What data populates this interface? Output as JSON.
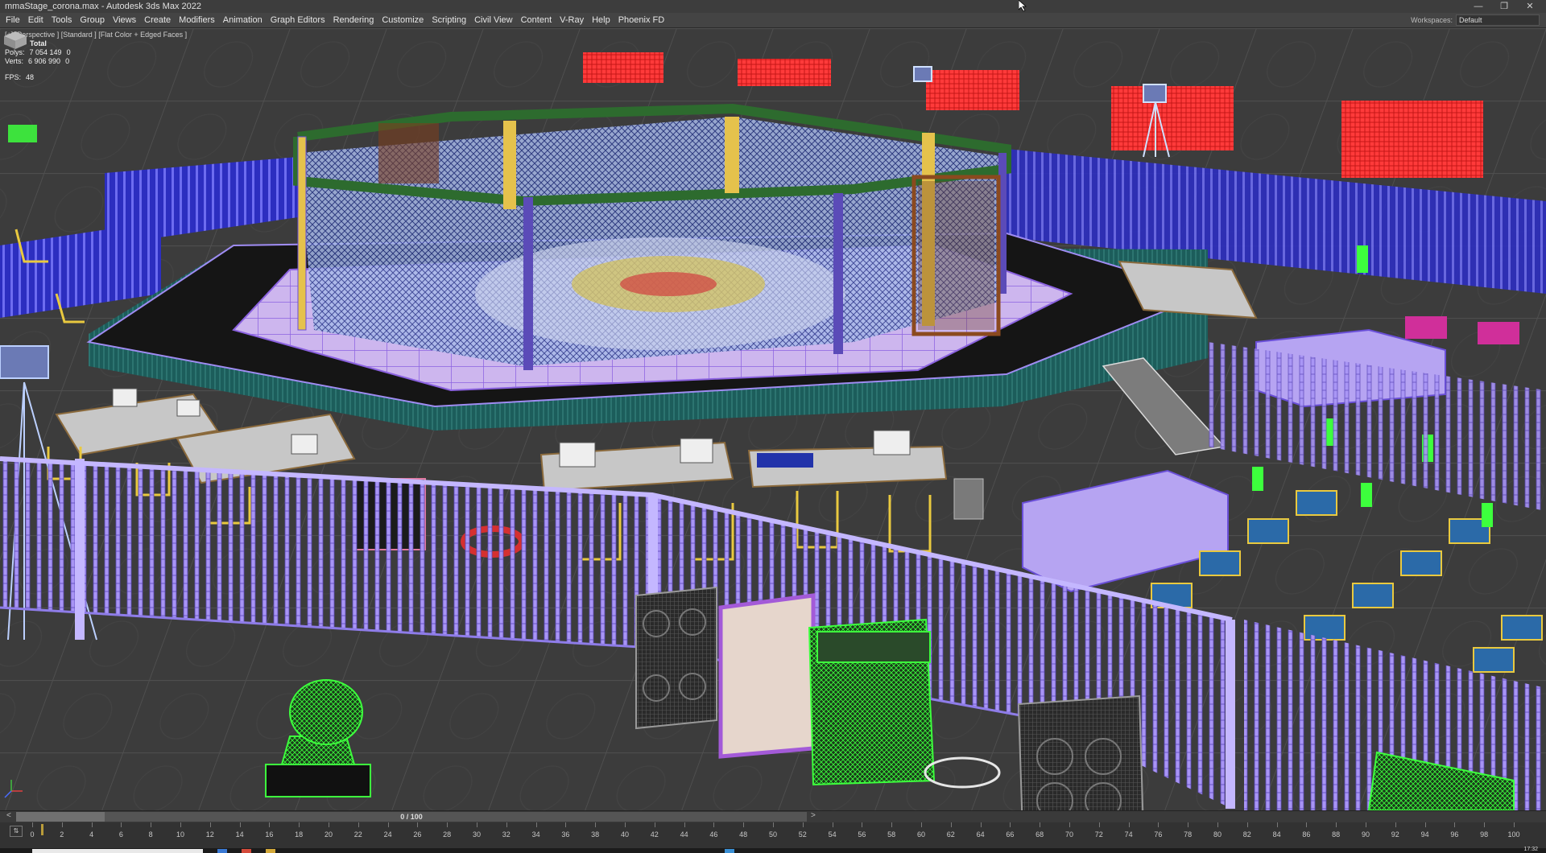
{
  "window": {
    "title": "mmaStage_corona.max - Autodesk 3ds Max 2022",
    "buttons": [
      "minimize",
      "restore",
      "close"
    ]
  },
  "menubar": {
    "items": [
      "File",
      "Edit",
      "Tools",
      "Group",
      "Views",
      "Create",
      "Modifiers",
      "Animation",
      "Graph Editors",
      "Rendering",
      "Customize",
      "Scripting",
      "Civil View",
      "Content",
      "V-Ray",
      "Help",
      "Phoenix FD"
    ],
    "workspace_label": "Workspaces:",
    "workspace_value": "Default"
  },
  "viewport": {
    "label": "[+] [Perspective ] [Standard ] [Flat Color + Edged Faces ]",
    "filter_icon": "funnel-icon",
    "stats": {
      "header": "Total",
      "polys_label": "Polys:",
      "polys_value": "7 054 149",
      "polys_sel": "0",
      "verts_label": "Verts:",
      "verts_value": "6 906 990",
      "verts_sel": "0",
      "fps_label": "FPS:",
      "fps_value": "48"
    },
    "viewcube_icon": "viewcube-icon"
  },
  "timeslider": {
    "frame": "0 / 100",
    "prev_icon": "chevron-left-icon",
    "next_icon": "chevron-right-icon"
  },
  "timeline": {
    "ticks": [
      "0",
      "2",
      "4",
      "6",
      "8",
      "10",
      "12",
      "14",
      "16",
      "18",
      "20",
      "22",
      "24",
      "26",
      "28",
      "30",
      "32",
      "34",
      "36",
      "38",
      "40",
      "42",
      "44",
      "46",
      "48",
      "50",
      "52",
      "54",
      "56",
      "58",
      "60",
      "62",
      "64",
      "66",
      "68",
      "70",
      "72",
      "74",
      "76",
      "78",
      "80",
      "82",
      "84",
      "86",
      "88",
      "90",
      "92",
      "94",
      "96",
      "98",
      "100"
    ]
  },
  "taskbar": {
    "clock": "17:32"
  },
  "colors": {
    "fence": "#9f8cf2",
    "cage_frame": "#2d6b2e",
    "cage_post": "#e5c24c",
    "floor": "#3a3a3a",
    "backdrop": "#ff3030",
    "green_selected": "#3dff3d",
    "stage_skirt": "#1f5e5a",
    "chair": "#e9c93f"
  }
}
